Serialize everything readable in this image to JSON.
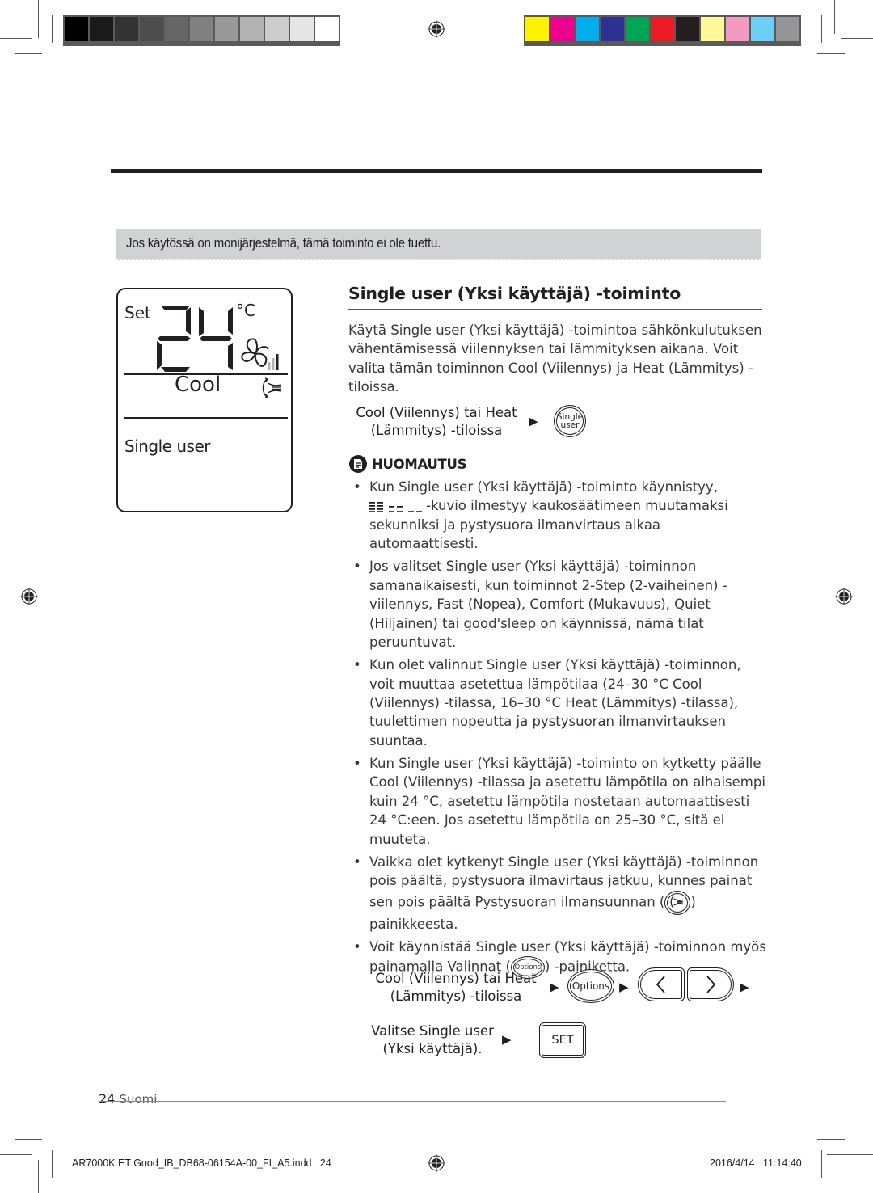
{
  "print_marks": {
    "grayscale_swatches": [
      "#000000",
      "#1a1a1a",
      "#333333",
      "#4d4d4d",
      "#666666",
      "#808080",
      "#999999",
      "#b3b3b3",
      "#cccccc",
      "#e6e6e6",
      "#ffffff"
    ],
    "color_swatches": [
      "#fff200",
      "#ec008c",
      "#00aeef",
      "#2e3192",
      "#00a651",
      "#ed1c24",
      "#231f20",
      "#fff799",
      "#f49ac1",
      "#6dcff6",
      "#939598"
    ]
  },
  "notice": {
    "text": "Jos käytössä on monijärjestelmä, tämä toiminto ei ole tuettu."
  },
  "lcd": {
    "set_label": "Set",
    "temperature": "24",
    "unit": "°C",
    "mode": "Cool",
    "function_label": "Single user",
    "fan_level_bars": 3,
    "fan_level_active": 1
  },
  "section": {
    "title": "Single user (Yksi käyttäjä) -toiminto",
    "intro": "Käytä Single user (Yksi käyttäjä) -toimintoa sähkönkulutuksen vähentämisessä viilennyksen tai lämmityksen aikana. Voit valita tämän toiminnon Cool (Viilennys) ja Heat (Lämmitys) -tiloissa.",
    "step1": {
      "line1": "Cool (Viilennys) tai Heat",
      "line2": "(Lämmitys) -tiloissa",
      "button_line1": "Single",
      "button_line2": "user"
    },
    "note_heading": "HUOMAUTUS",
    "notes": [
      {
        "before": "Kun Single user (Yksi käyttäjä) -toiminto käynnistyy,",
        "after": "-kuvio ilmestyy kaukosäätimeen muutamaksi sekunniksi ja pystysuora ilmanvirtaus alkaa automaattisesti."
      },
      {
        "text": "Jos valitset Single user (Yksi käyttäjä) -toiminnon samanaikaisesti, kun toiminnot 2-Step (2-vaiheinen) -viilennys, Fast (Nopea), Comfort (Mukavuus), Quiet (Hiljainen) tai good'sleep on käynnissä, nämä tilat peruuntuvat."
      },
      {
        "text": "Kun olet valinnut Single user (Yksi käyttäjä) -toiminnon, voit muuttaa asetettua lämpötilaa (24–30 °C Cool (Viilennys) -tilassa, 16–30 °C Heat (Lämmitys) -tilassa), tuulettimen nopeutta ja pystysuoran ilmanvirtauksen suuntaa."
      },
      {
        "text": "Kun Single user (Yksi käyttäjä) -toiminto on kytketty päälle Cool (Viilennys) -tilassa ja asetettu lämpötila on alhaisempi kuin 24 °C, asetettu lämpötila nostetaan automaattisesti 24 °C:een. Jos asetettu lämpötila on 25–30 °C, sitä ei muuteta."
      },
      {
        "before": "Vaikka olet kytkenyt Single user (Yksi käyttäjä) -toiminnon pois päältä, pystysuora ilmavirtaus jatkuu, kunnes painat sen pois päältä Pystysuoran ilmansuunnan (",
        "after": ") painikkeesta."
      },
      {
        "before": "Voit käynnistää Single user (Yksi käyttäjä) -toiminnon myös painamalla Valinnat (",
        "button": "Options",
        "after": ") -painiketta."
      }
    ],
    "step2": {
      "line1": "Cool (Viilennys) tai Heat",
      "line2": "(Lämmitys) -tiloissa",
      "options_label": "Options"
    },
    "step3": {
      "line1": "Valitse Single user",
      "line2": "(Yksi käyttäjä).",
      "set_label": "SET"
    }
  },
  "footer": {
    "page_number": "24",
    "language": "Suomi",
    "slug": "AR7000K ET Good_IB_DB68-06154A-00_FI_A5.indd   24",
    "timestamp": "2016/4/14   11:14:40"
  }
}
